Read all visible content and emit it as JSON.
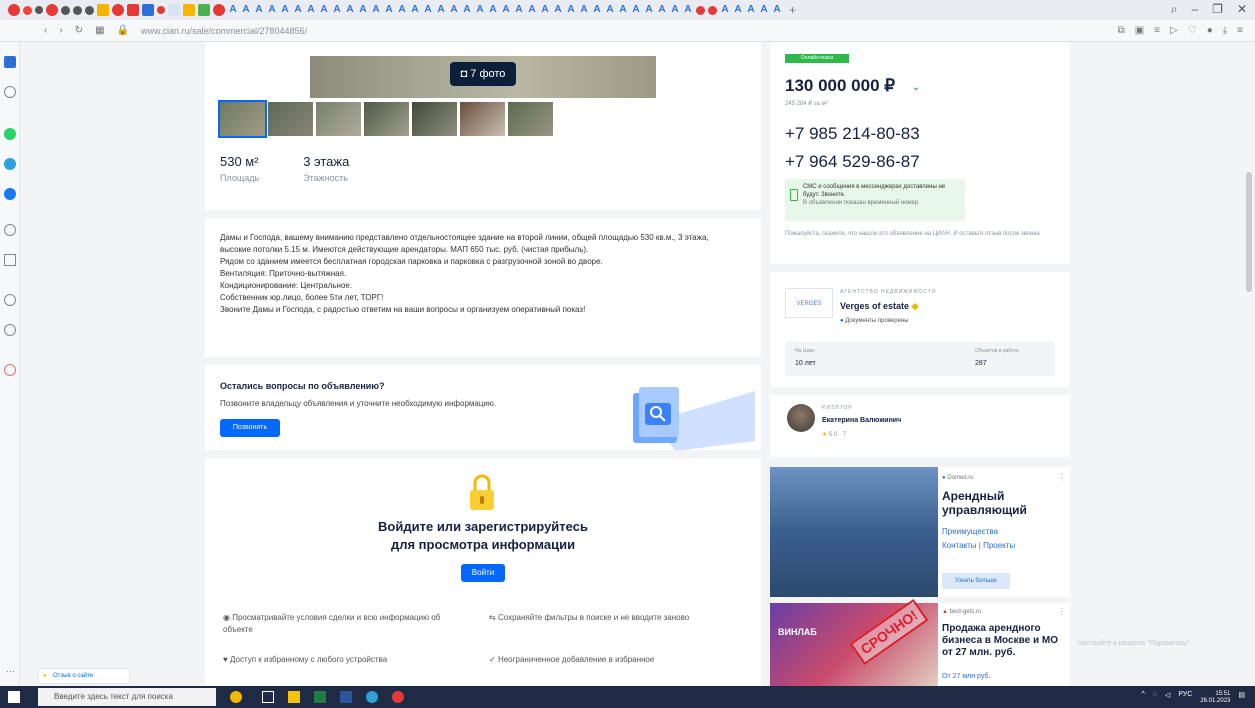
{
  "browser": {
    "url": "www.cian.ru/sale/commercial/278044856/"
  },
  "photos": {
    "button": "7 фото"
  },
  "facts": [
    {
      "value": "530 м²",
      "label": "Площадь"
    },
    {
      "value": "3 этажа",
      "label": "Этажность"
    }
  ],
  "description": [
    "Дамы и Господа, вашему вниманию представлено отдельностоящее здание на второй линии, общей площадью 530 кв.м., 3 этажа, высокие потолки 5.15 м. Имеются действующие арендаторы. МАП 650 тыс. руб. (чистая прибыль).",
    "Рядом со зданием имеется бесплатная городская парковка и парковка с разгрузочной зоной во дворе.",
    "Вентиляция: Приточно-вытяжная.",
    "Кондиционирование: Центральное.",
    "Собственник юр.лицо, более 5ти лет, ТОРГ!",
    "Звоните Дамы и Господа, с радостью ответим на ваши вопросы и организуем оперативный показ!"
  ],
  "questions": {
    "title": "Остались вопросы по объявлению?",
    "text": "Позвоните владельцу объявления и уточните необходимую информацию.",
    "button": "Позвонить"
  },
  "login": {
    "title1": "Войдите или зарегистрируйтесь",
    "title2": "для просмотра информации",
    "button": "Войти",
    "features": [
      "Просматривайте условия сделки и всю информацию об объекте",
      "Сохраняйте фильтры в поиске и не вводите заново",
      "Доступ к избранному с любого устройства",
      "Неограниченное добавление в избранное"
    ]
  },
  "offer": {
    "badge": "Онлайн-показ",
    "price": "130 000 000 ₽",
    "per_sqm": "245 284 ₽ за м²",
    "phones": [
      "+7 985 214-80-83",
      "+7 964 529-86-87"
    ],
    "sms_note_1": "СМС и сообщения в мессенджерах доставлены не будут. Звоните.",
    "sms_note_2": "В объявлении показан временный номер",
    "agency_note": "Пожалуйста, скажите, что нашли это объявление на ЦИАН. И оставьте отзыв после звонка"
  },
  "agency": {
    "type": "АГЕНТСТВО НЕДВИЖИМОСТИ",
    "name": "Verges of estate",
    "logo": "VERGES",
    "verified": "Документы проверены",
    "stats": [
      {
        "label": "На Циан",
        "value": "10 лет"
      },
      {
        "label": "Объектов в работе",
        "value": "287"
      }
    ]
  },
  "realtor": {
    "type": "РИЭЛТОР",
    "name": "Екатерина Валюжинич",
    "rating": "5.0 · 7"
  },
  "ads": [
    {
      "source": "Domed.ru",
      "title": "Арендный управляющий",
      "links": "Преимущества",
      "links2": "Контакты | Проекты",
      "button": "Узнать больше"
    },
    {
      "source": "best-gets.ru",
      "title": "Продажа арендного бизнеса в Москве и МО от 27 млн. руб.",
      "sub": "От 27 млн руб.",
      "stamp": "СРОЧНО!",
      "image_text": "ВИНЛАБ"
    }
  ],
  "overlay_hint": "настройте в разделе \"Параметры\".",
  "feedback": "Отзыв о сайте",
  "taskbar": {
    "search": "Введите здесь текст для поиска",
    "lang": "РУС",
    "time": "15:51",
    "date": "26.01.2023"
  },
  "colors": {
    "primary": "#0468ff",
    "badge": "#2fb84b",
    "text": "#152242",
    "stamp": "#d8202a"
  }
}
